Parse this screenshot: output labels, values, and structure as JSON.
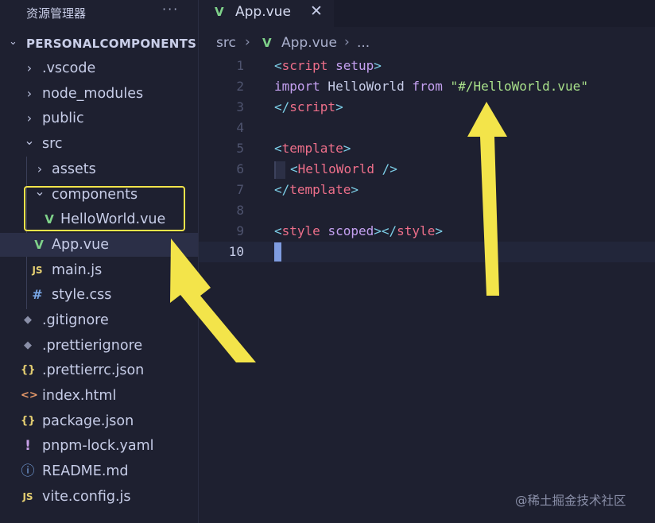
{
  "sidebar": {
    "title": "资源管理器",
    "more": "···",
    "project": {
      "chevron": "⌄",
      "name": "PERSONALCOMPONENTS"
    },
    "items": [
      {
        "label": ".vscode",
        "icon": "chevron-right-icon",
        "glyph": "›"
      },
      {
        "label": "node_modules",
        "icon": "chevron-right-icon",
        "glyph": "›"
      },
      {
        "label": "public",
        "icon": "chevron-right-icon",
        "glyph": "›"
      },
      {
        "label": "src",
        "icon": "chevron-down-icon",
        "glyph": "⌄"
      },
      {
        "label": "assets",
        "icon": "chevron-right-icon",
        "glyph": "›"
      },
      {
        "label": "components",
        "icon": "chevron-down-icon",
        "glyph": "⌄"
      },
      {
        "label": "HelloWorld.vue",
        "icon": "vue-icon",
        "glyph": "V"
      },
      {
        "label": "App.vue",
        "icon": "vue-icon",
        "glyph": "V"
      },
      {
        "label": "main.js",
        "icon": "js-icon",
        "glyph": "JS"
      },
      {
        "label": "style.css",
        "icon": "hash-icon",
        "glyph": "#"
      },
      {
        "label": ".gitignore",
        "icon": "git-icon",
        "glyph": "◆"
      },
      {
        "label": ".prettierignore",
        "icon": "git-icon",
        "glyph": "◆"
      },
      {
        "label": ".prettierrc.json",
        "icon": "json-icon",
        "glyph": "{}"
      },
      {
        "label": "index.html",
        "icon": "html-icon",
        "glyph": "<>"
      },
      {
        "label": "package.json",
        "icon": "json-icon",
        "glyph": "{}"
      },
      {
        "label": "pnpm-lock.yaml",
        "icon": "yaml-icon",
        "glyph": "!"
      },
      {
        "label": "README.md",
        "icon": "info-icon",
        "glyph": "ⓘ"
      },
      {
        "label": "vite.config.js",
        "icon": "js-icon",
        "glyph": "JS"
      }
    ]
  },
  "editor": {
    "tab": {
      "icon": "V",
      "label": "App.vue",
      "close": "✕"
    },
    "breadcrumb": {
      "folder": "src",
      "sep": "›",
      "icon": "V",
      "file": "App.vue",
      "more": "..."
    },
    "line_numbers": [
      "1",
      "2",
      "3",
      "4",
      "5",
      "6",
      "7",
      "8",
      "9",
      "10"
    ],
    "code": {
      "l1_open": "<",
      "l1_tag": "script",
      "l1_attr": " setup",
      "l1_close": ">",
      "l2_import": "import",
      "l2_name": " HelloWorld ",
      "l2_from": "from",
      "l2_str": " \"#/HelloWorld.vue\"",
      "l3_open": "</",
      "l3_tag": "script",
      "l3_close": ">",
      "l5_open": "<",
      "l5_tag": "template",
      "l5_close": ">",
      "l6_open": "<",
      "l6_comp": "HelloWorld",
      "l6_close": " />",
      "l7_open": "</",
      "l7_tag": "template",
      "l7_close": ">",
      "l9_open": "<",
      "l9_tag": "style",
      "l9_attr": " scoped",
      "l9_mid": "></",
      "l9_tag2": "style",
      "l9_close": ">"
    }
  },
  "watermark": "@稀土掘金技术社区",
  "colors": {
    "background": "#1e2030",
    "highlight": "#f3e44a",
    "vue_green": "#7fd28a",
    "tag_pink": "#ee6f8a"
  }
}
